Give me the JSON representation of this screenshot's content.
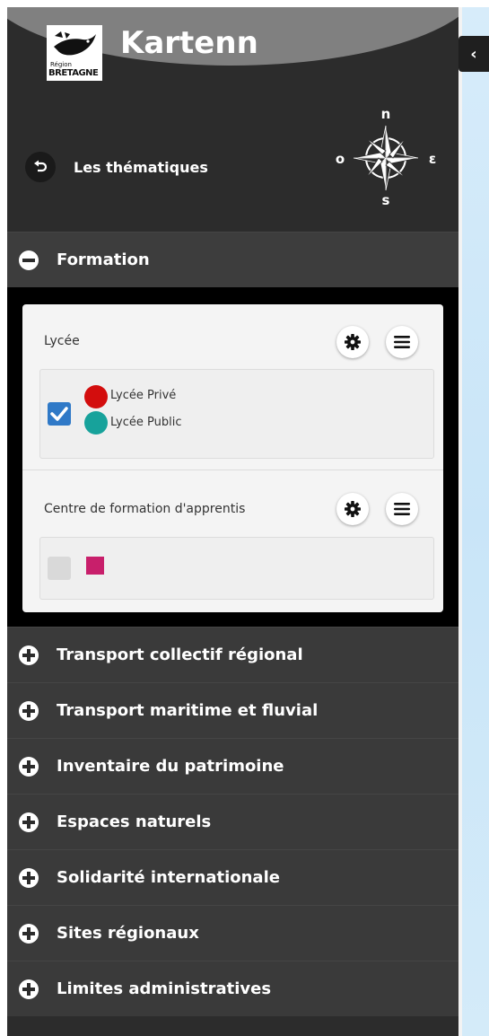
{
  "header": {
    "logo": {
      "region_text": "Région",
      "brand_text": "BRETAGNE"
    },
    "title": "Kartenn",
    "back_label": "Les thématiques",
    "compass": {
      "n": "n",
      "s": "s",
      "e": "ε",
      "w": "o"
    }
  },
  "collapse_icon": "‹",
  "sections": [
    {
      "label": "Formation",
      "expanded": true
    },
    {
      "label": "Transport collectif régional",
      "expanded": false
    },
    {
      "label": "Transport maritime et fluvial",
      "expanded": false
    },
    {
      "label": "Inventaire du patrimoine",
      "expanded": false
    },
    {
      "label": "Espaces naturels",
      "expanded": false
    },
    {
      "label": "Solidarité internationale",
      "expanded": false
    },
    {
      "label": "Sites régionaux",
      "expanded": false
    },
    {
      "label": "Limites administratives",
      "expanded": false
    }
  ],
  "formation": {
    "layers": [
      {
        "title": "Lycée",
        "checked": true,
        "legend": [
          {
            "label": "Lycée Privé",
            "color": "#d30d0d"
          },
          {
            "label": "Lycée Public",
            "color": "#17a29b"
          }
        ]
      },
      {
        "title": "Centre de formation d'apprentis",
        "checked": false,
        "legend": [
          {
            "label": "",
            "color": "#c81f6b"
          }
        ]
      }
    ]
  },
  "colors": {
    "panel_bg": "#2c2c2c",
    "section_bg": "#3a3a3a",
    "checkbox_on": "#2f79c7",
    "map_bg": "#cde7f8"
  }
}
